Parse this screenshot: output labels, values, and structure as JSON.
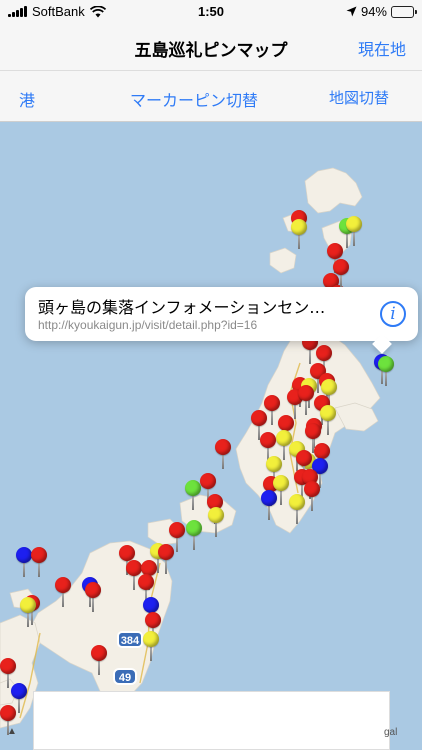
{
  "status": {
    "carrier": "SoftBank",
    "time": "1:50",
    "battery": "94%",
    "battery_level": 0.94
  },
  "nav": {
    "title": "五島巡礼ピンマップ",
    "current_location": "現在地"
  },
  "toolbar": {
    "port": "港",
    "marker_toggle": "マーカーピン切替",
    "map_toggle": "地図切替"
  },
  "callout": {
    "title": "頭ヶ島の集落インフォメーションセン…",
    "url": "http://kyoukaigun.jp/visit/detail.php?id=16",
    "info_glyph": "i"
  },
  "road_signs": {
    "r384": "384",
    "r49": "49"
  },
  "map_footer": {
    "legal": "gal"
  },
  "colors": {
    "accent": "#2f7bf6",
    "pin_red": "#e8211c",
    "pin_yellow": "#f2ef3b",
    "pin_green": "#6de23d",
    "pin_blue": "#1d1ff0"
  }
}
